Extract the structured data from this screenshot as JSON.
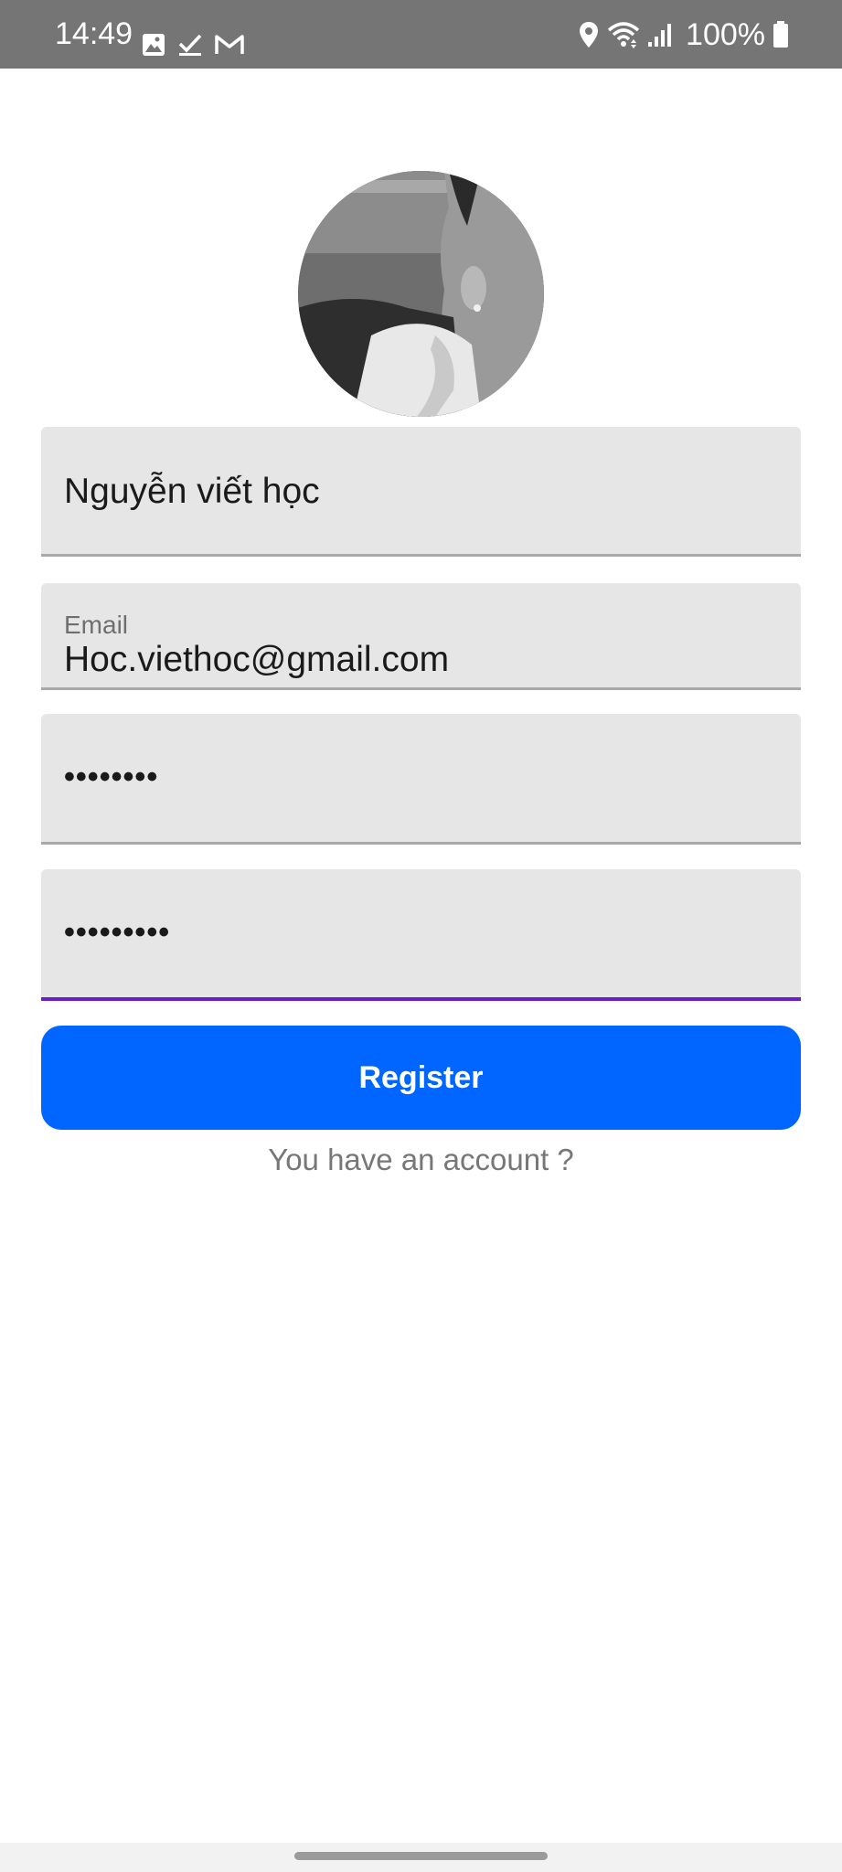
{
  "status_bar": {
    "time": "14:49",
    "battery": "100%",
    "left_icons": [
      "image-icon",
      "check-icon",
      "gmail-icon"
    ],
    "right_icons": [
      "location-icon",
      "wifi-icon",
      "signal-icon",
      "battery-icon"
    ]
  },
  "avatar": {
    "icon": "profile-photo"
  },
  "form": {
    "name_value": "Nguyễn viết học",
    "email_label": "Email",
    "email_value": "Hoc.viethoc@gmail.com",
    "password_value": "••••••••",
    "confirm_password_value": "•••••••••"
  },
  "actions": {
    "register_label": "Register",
    "login_link": "You have an account ?"
  },
  "colors": {
    "status_bar": "#757575",
    "field_bg": "#e6e6e6",
    "focus_underline": "#6a1fc9",
    "primary": "#0066ff",
    "link_text": "#777777"
  }
}
